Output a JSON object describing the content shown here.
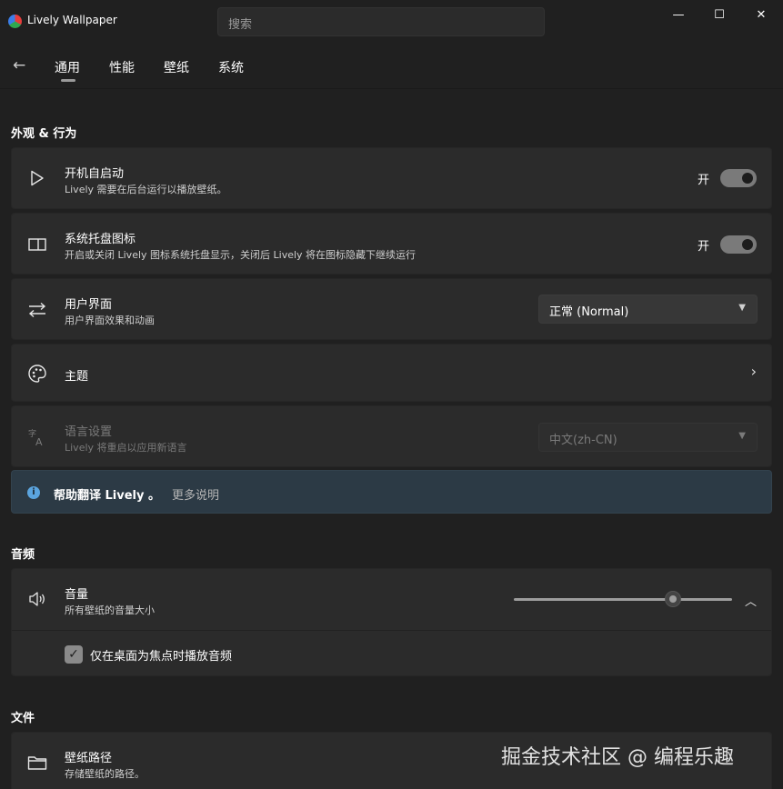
{
  "window": {
    "title": "Lively Wallpaper",
    "search_placeholder": "搜索",
    "minimize": "—",
    "maximize": "☐",
    "close": "✕"
  },
  "nav": {
    "back": "←",
    "tabs": [
      {
        "label": "通用",
        "selected": true
      },
      {
        "label": "性能"
      },
      {
        "label": "壁纸"
      },
      {
        "label": "系统"
      }
    ]
  },
  "sections": {
    "appearance": "外观 & 行为",
    "audio": "音频",
    "files": "文件"
  },
  "settings": {
    "startup": {
      "title": "开机自启动",
      "subtitle": "Lively 需要在后台运行以播放壁纸。",
      "toggle_label": "开",
      "icon": "play-icon"
    },
    "tray": {
      "title": "系统托盘图标",
      "subtitle": "开启或关闭 Lively 图标系统托盘显示，关闭后 Lively 将在图标隐藏下继续运行",
      "toggle_label": "开",
      "icon": "panel-icon"
    },
    "ui": {
      "title": "用户界面",
      "subtitle": "用户界面效果和动画",
      "value": "正常 (Normal)",
      "icon": "swap-arrows-icon"
    },
    "theme": {
      "title": "主题",
      "icon": "palette-icon"
    },
    "language": {
      "title": "语言设置",
      "subtitle": "Lively 将重启以应用新语言",
      "value": "中文(zh-CN)",
      "icon": "language-icon",
      "disabled": true
    }
  },
  "info": {
    "text": "帮助翻译 Lively 。",
    "link": "更多说明"
  },
  "audio": {
    "title": "音量",
    "subtitle": "所有壁纸的音量大小",
    "volume_fraction": 0.73,
    "focus_checkbox_label": "仅在桌面为焦点时播放音频",
    "focus_checked": true
  },
  "files": {
    "title": "壁纸路径",
    "subtitle": "存储壁纸的路径。"
  },
  "watermark": "掘金技术社区 @ 编程乐趣",
  "colors": {
    "background": "#202020",
    "card": "#2b2b2b",
    "info_bar": "#2c3a45",
    "info_icon": "#5ba4de",
    "toggle_on": "#7a7a7a"
  }
}
